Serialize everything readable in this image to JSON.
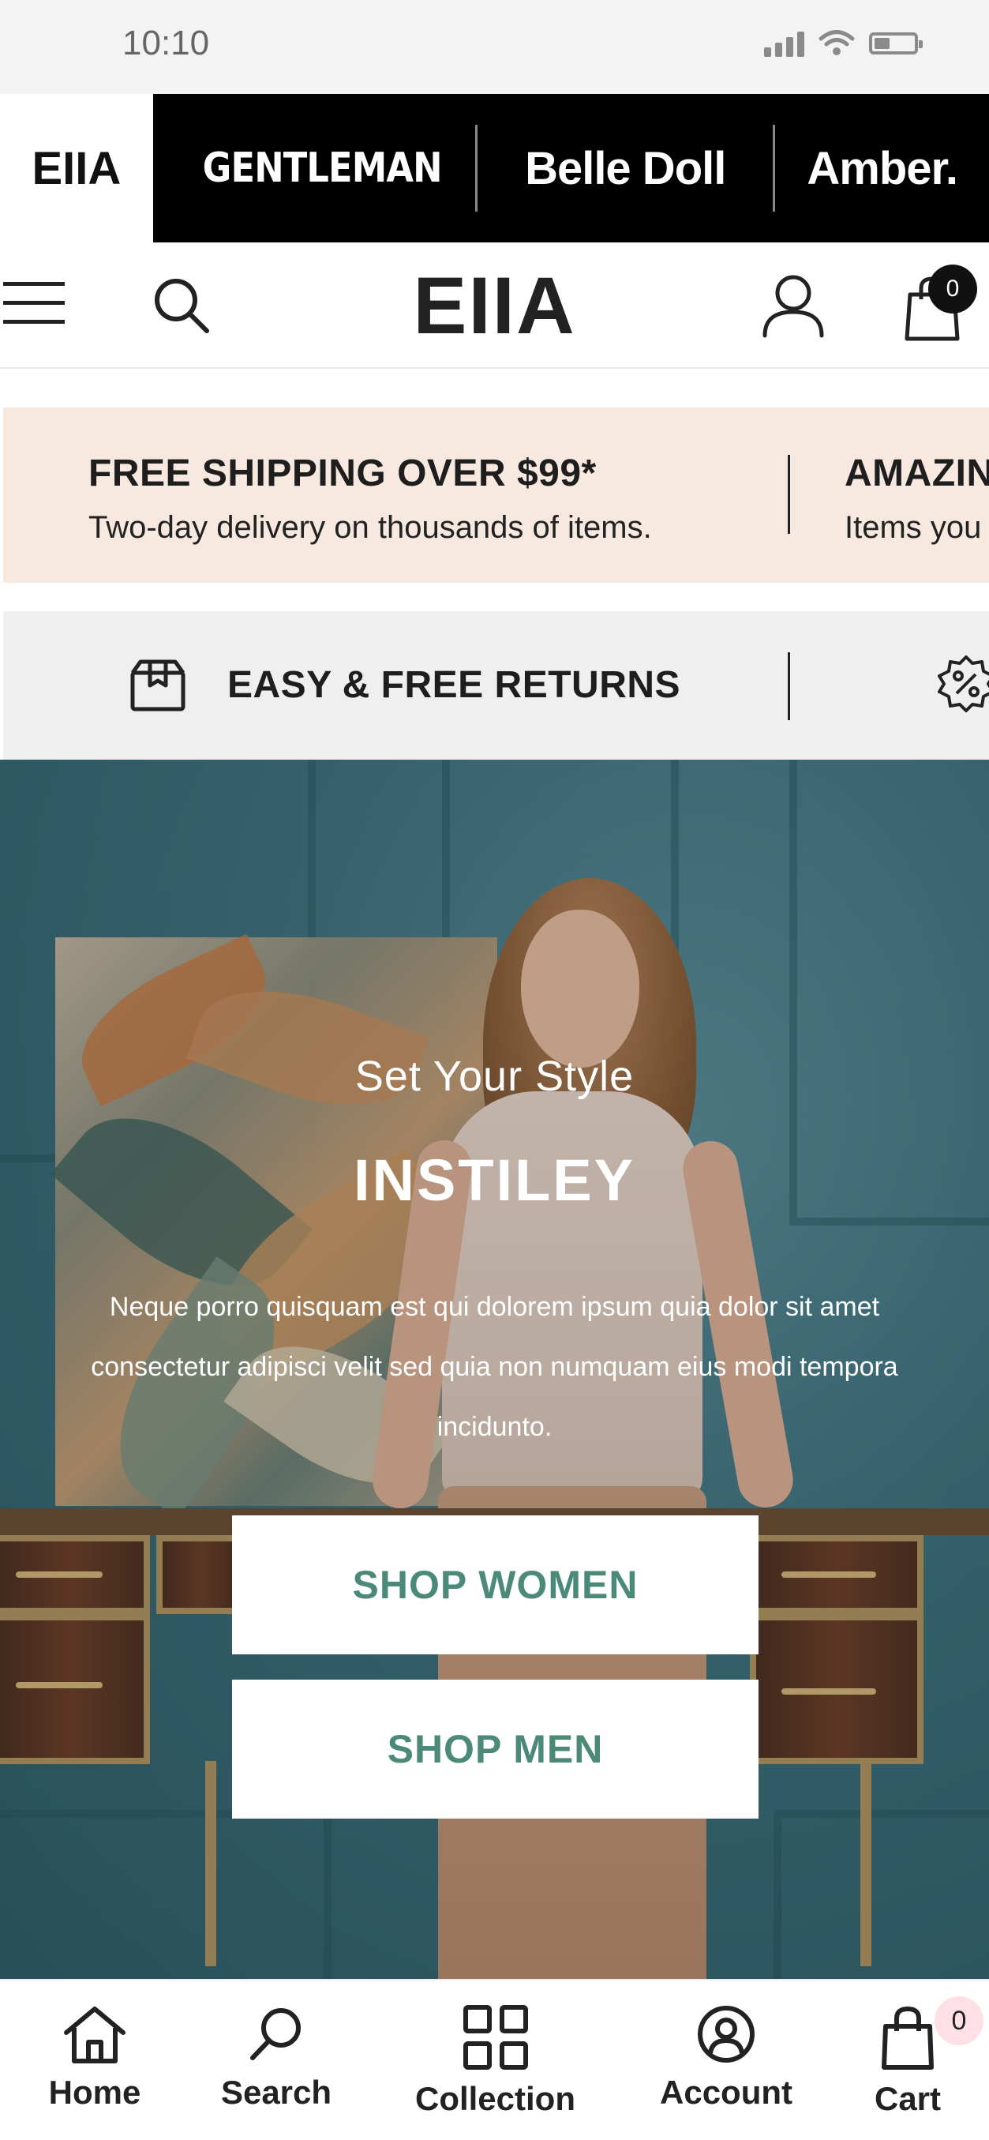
{
  "status_bar": {
    "time": "10:10"
  },
  "brand_strip": {
    "items": [
      {
        "label": "EIIA",
        "active": true
      },
      {
        "label": "GENTLEMAN",
        "active": false
      },
      {
        "label": "Belle Doll",
        "active": false
      },
      {
        "label": "Amber.",
        "active": false
      }
    ]
  },
  "header": {
    "logo": "EIIA",
    "icons": [
      "menu-icon",
      "search-icon",
      "account-icon",
      "cart-icon"
    ],
    "cart_count": "0"
  },
  "promos": {
    "shipping": {
      "title": "FREE SHIPPING OVER $99*",
      "subtitle": "Two-day delivery on thousands of items."
    },
    "next_partial": {
      "title": "AMAZIN",
      "subtitle": "Items you"
    },
    "returns": {
      "title": "EASY & FREE RETURNS",
      "icon": "box-icon",
      "next_icon": "discount-icon"
    }
  },
  "hero": {
    "subtitle": "Set Your Style",
    "title": "INSTILEY",
    "description": "Neque porro quisquam est qui dolorem ipsum quia dolor sit amet consectetur adipisci velit sed quia non numquam eius modi tempora incidunto.",
    "buttons": [
      "SHOP WOMEN",
      "SHOP MEN"
    ]
  },
  "bottom_nav": {
    "items": [
      {
        "label": "Home",
        "icon": "home-icon"
      },
      {
        "label": "Search",
        "icon": "search-icon"
      },
      {
        "label": "Collection",
        "icon": "grid-icon"
      },
      {
        "label": "Account",
        "icon": "account-icon"
      },
      {
        "label": "Cart",
        "icon": "cart-icon"
      }
    ],
    "cart_count": "0"
  },
  "colors": {
    "accent": "#4b8a78",
    "promo_bg": "#f8e9e0",
    "brand_strip_bg": "#000000"
  }
}
